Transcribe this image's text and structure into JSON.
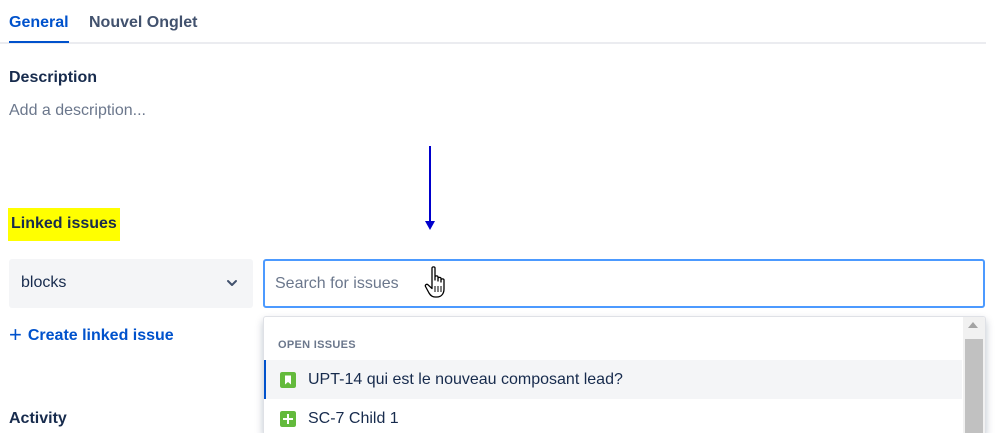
{
  "tabs": [
    {
      "label": "General",
      "active": true
    },
    {
      "label": "Nouvel Onglet",
      "active": false
    }
  ],
  "description": {
    "heading": "Description",
    "placeholder": "Add a description..."
  },
  "linked_issues": {
    "heading": "Linked issues",
    "link_type": "blocks",
    "search_placeholder": "Search for issues",
    "create_label": "Create linked issue"
  },
  "dropdown": {
    "group_label": "OPEN ISSUES",
    "items": [
      {
        "text": "UPT-14 qui est le nouveau composant lead?",
        "icon": "story-icon",
        "icon_color": "#63ba3c",
        "selected": true
      },
      {
        "text": "SC-7 Child 1",
        "icon": "new-feature-icon",
        "icon_color": "#63ba3c",
        "selected": false
      }
    ]
  },
  "activity": {
    "heading": "Activity"
  },
  "colors": {
    "accent": "#0052cc",
    "highlight": "#ffff00",
    "focus_border": "#4c9aff",
    "annotation_arrow": "#0000cc"
  }
}
